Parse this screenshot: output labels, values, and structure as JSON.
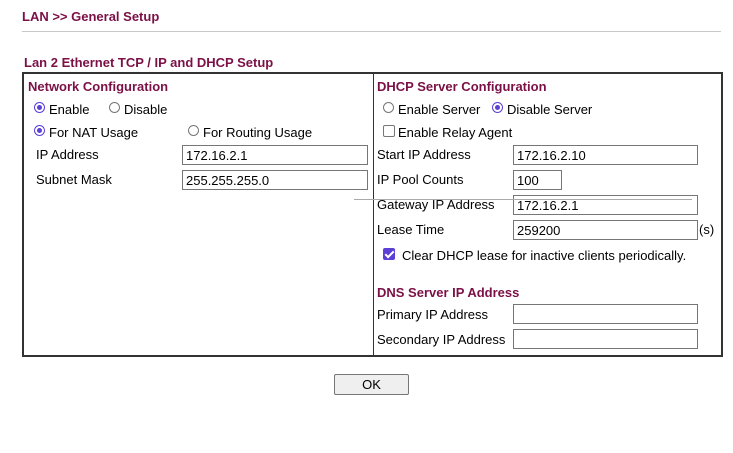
{
  "breadcrumb": "LAN >> General Setup",
  "section_title": "Lan 2 Ethernet TCP / IP and DHCP Setup",
  "network": {
    "title": "Network Configuration",
    "enable_label": "Enable",
    "disable_label": "Disable",
    "nat_label": "For NAT Usage",
    "routing_label": "For Routing Usage",
    "ip_label": "IP Address",
    "ip_value": "172.16.2.1",
    "mask_label": "Subnet Mask",
    "mask_value": "255.255.255.0",
    "enabled": true,
    "mode": "nat"
  },
  "dhcp": {
    "title": "DHCP Server Configuration",
    "enable_server_label": "Enable Server",
    "disable_server_label": "Disable Server",
    "server_state": "disable",
    "relay_label": "Enable Relay Agent",
    "relay_checked": false,
    "start_ip_label": "Start IP Address",
    "start_ip_value": "172.16.2.10",
    "pool_label": "IP Pool Counts",
    "pool_value": "100",
    "gateway_label": "Gateway IP Address",
    "gateway_value": "172.16.2.1",
    "lease_label": "Lease Time",
    "lease_value": "259200",
    "lease_unit": "(s)",
    "clear_label": "Clear DHCP lease for inactive clients periodically.",
    "clear_checked": true
  },
  "dns": {
    "title": "DNS Server IP Address",
    "primary_label": "Primary IP Address",
    "primary_value": "",
    "secondary_label": "Secondary IP Address",
    "secondary_value": ""
  },
  "ok_label": "OK",
  "colors": {
    "accent": "#7b1046",
    "check": "#5b3fd6"
  }
}
